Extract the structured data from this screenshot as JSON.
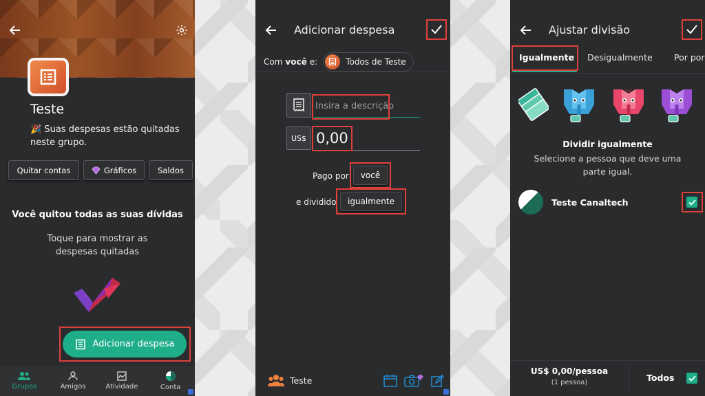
{
  "screen1": {
    "group_name": "Teste",
    "status_emoji": "🎉",
    "status_text": "Suas despesas estão quitadas neste grupo.",
    "chips": [
      "Quitar contas",
      "Gráficos",
      "Saldos"
    ],
    "settled_title": "Você quitou todas as suas dívidas",
    "settled_sub": "Toque para mostrar as despesas quitadas",
    "add_expense_label": "Adicionar despesa",
    "nav": [
      {
        "label": "Grupos",
        "icon": "group-icon"
      },
      {
        "label": "Amigos",
        "icon": "person-icon"
      },
      {
        "label": "Atividade",
        "icon": "activity-icon"
      },
      {
        "label": "Conta",
        "icon": "account-icon"
      }
    ],
    "colors": {
      "accent": "#1fae8a",
      "highlight": "#e0403a"
    }
  },
  "screen2": {
    "title": "Adicionar despesa",
    "with_prefix": "Com ",
    "with_bold": "você",
    "with_suffix": " e:",
    "group_chip": "Todos de Teste",
    "description_placeholder": "Insira a descrição",
    "currency": "US$",
    "amount": "0,00",
    "paid_by_label": "Pago por",
    "paid_by_value": "você",
    "split_label": "e dividido",
    "split_value": "igualmente",
    "footer_group": "Teste"
  },
  "screen3": {
    "title": "Ajustar divisão",
    "tabs": [
      "Igualmente",
      "Desigualmente",
      "Por porcentagem"
    ],
    "heading": "Dividir igualmente",
    "description": "Selecione a pessoa que deve uma parte igual.",
    "member_name": "Teste Canaltech",
    "per_person": "US$ 0,00/pessoa",
    "person_count": "(1 pessoa)",
    "all_label": "Todos"
  }
}
